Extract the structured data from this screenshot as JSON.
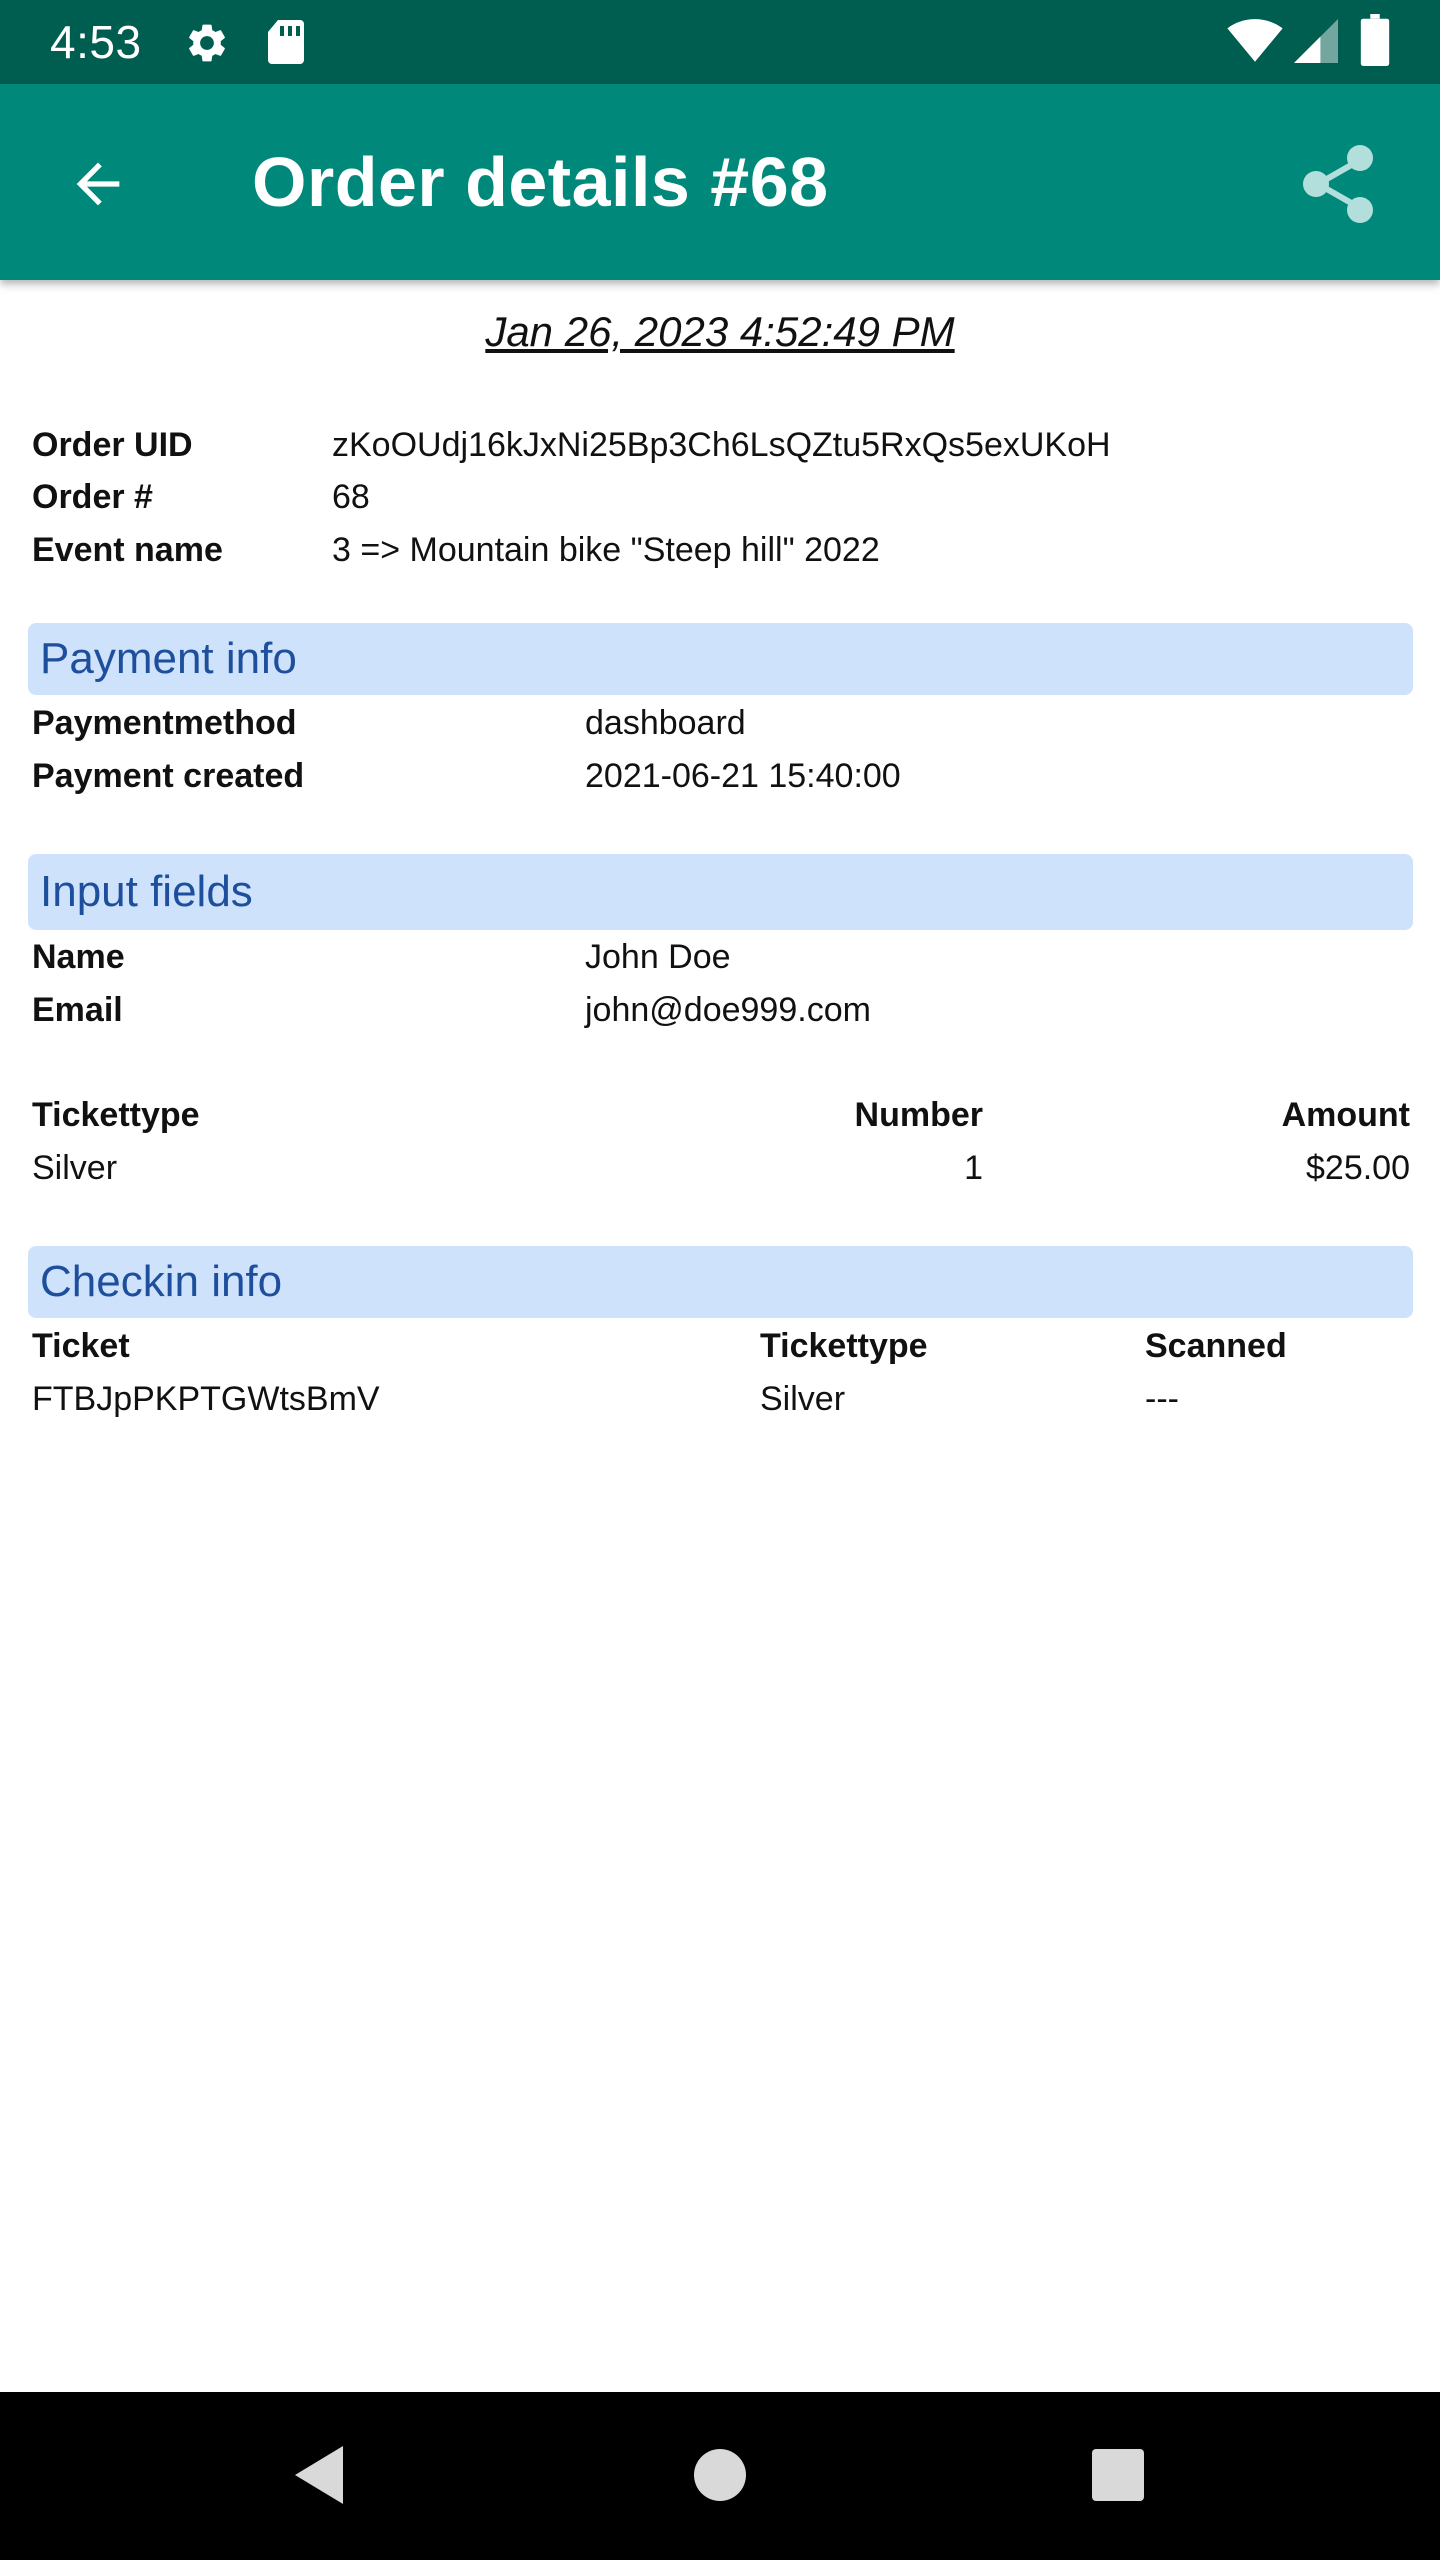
{
  "status_bar": {
    "time": "4:53",
    "icons": [
      "gear-icon",
      "sd-card-icon",
      "wifi-icon",
      "cellular-signal-icon",
      "battery-icon"
    ]
  },
  "app_bar": {
    "title": "Order details #68",
    "background": "#00897b",
    "status_background": "#005e50",
    "back_icon": "arrow-back-icon",
    "share_icon": "share-icon"
  },
  "order": {
    "date": "Jan 26, 2023 4:52:49 PM",
    "fields": [
      {
        "label": "Order UID",
        "value": "zKoOUdj16kJxNi25Bp3Ch6LsQZtu5RxQs5exUKoH"
      },
      {
        "label": "Order #",
        "value": "68"
      },
      {
        "label": "Event name",
        "value": "3 => Mountain bike \"Steep hill\" 2022"
      }
    ]
  },
  "payment_info": {
    "header": "Payment info",
    "fields": [
      {
        "label": "Paymentmethod",
        "value": "dashboard"
      },
      {
        "label": "Payment created",
        "value": "2021-06-21 15:40:00"
      }
    ]
  },
  "input_fields": {
    "header": "Input fields",
    "fields": [
      {
        "label": "Name",
        "value": "John Doe"
      },
      {
        "label": "Email",
        "value": "john@doe999.com"
      }
    ]
  },
  "tickets": {
    "columns": [
      "Tickettype",
      "Number",
      "Amount"
    ],
    "rows": [
      [
        "Silver",
        "1",
        "$25.00"
      ]
    ]
  },
  "checkin_info": {
    "header": "Checkin info",
    "columns": [
      "Ticket",
      "Tickettype",
      "Scanned"
    ],
    "rows": [
      [
        "FTBJpPKPTGWtsBmV",
        "Silver",
        "---"
      ]
    ]
  },
  "section_header_color": "#cfe2fc",
  "section_header_text_color": "#1e4f9c",
  "nav_bar": {
    "icons": [
      "back-triangle-icon",
      "home-circle-icon",
      "recents-square-icon"
    ]
  }
}
